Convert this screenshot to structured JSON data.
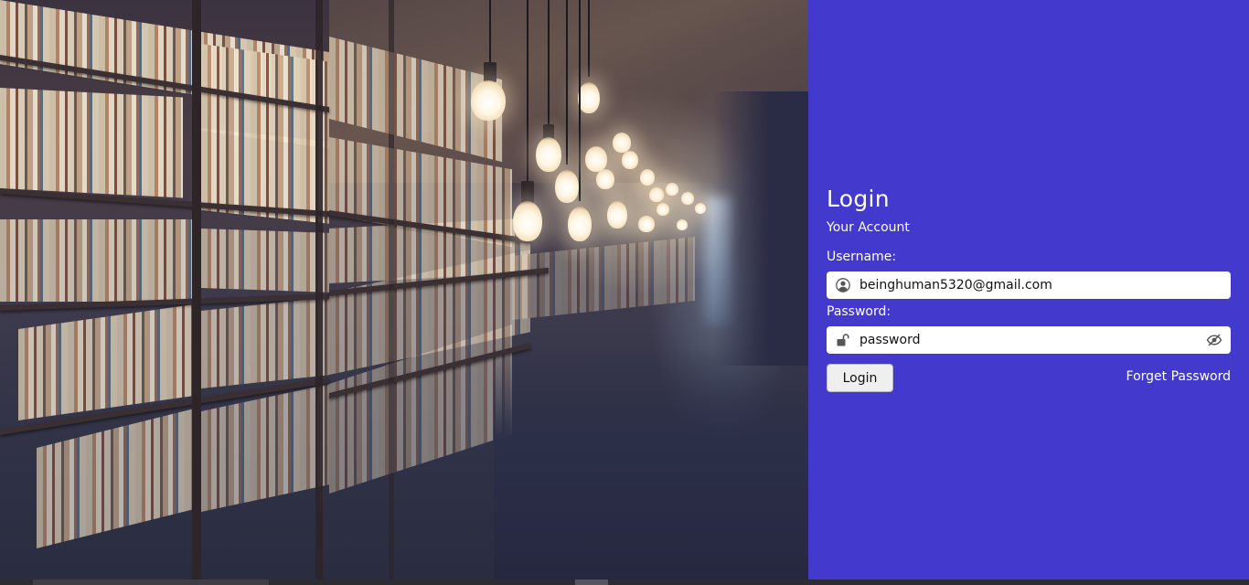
{
  "login": {
    "title": "Login",
    "subtitle": "Your Account",
    "username_label": "Username:",
    "username_value": "beinghuman5320@gmail.com",
    "password_label": "Password:",
    "password_value": "password",
    "login_button": "Login",
    "forgot_link": "Forget Password"
  },
  "icons": {
    "username": "user-circle-icon",
    "password": "unlock-icon",
    "toggle": "eye-slash-icon"
  },
  "colors": {
    "panel_bg": "#4339cc",
    "text": "#ffffff",
    "field_bg": "#ffffff",
    "button_bg": "#efefef"
  }
}
